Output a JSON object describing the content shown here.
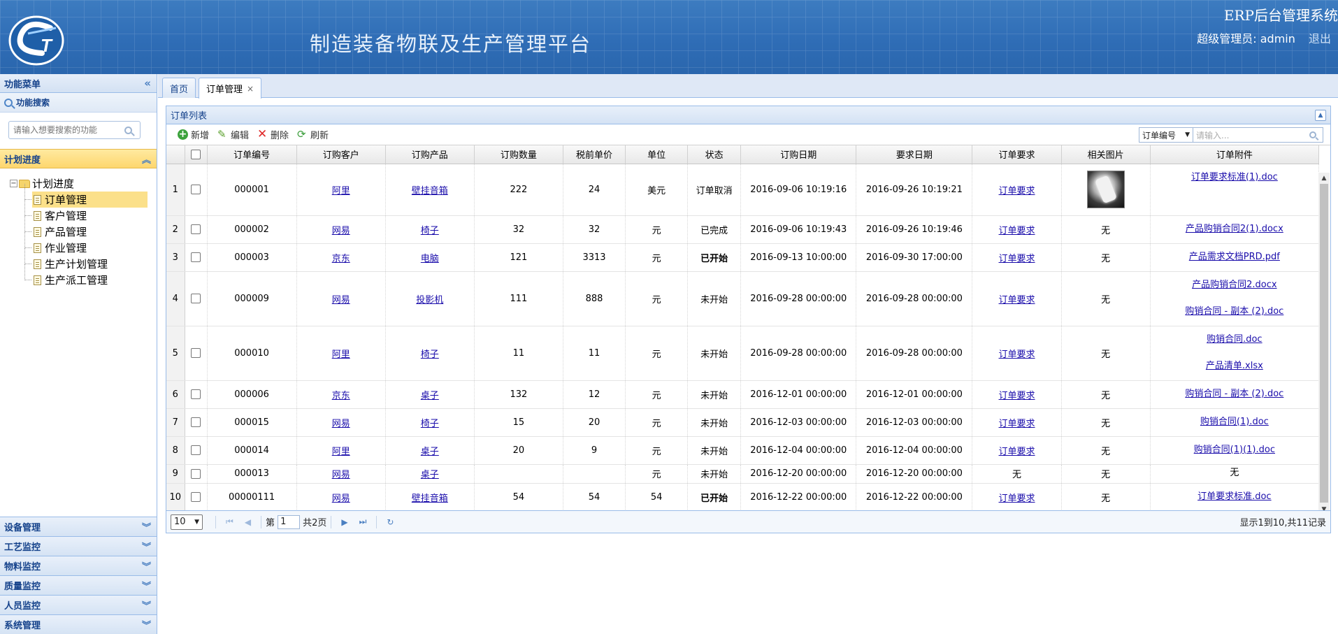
{
  "header": {
    "title": "制造装备物联及生产管理平台",
    "system_name": "ERP后台管理系统",
    "user_label": "超级管理员: admin",
    "logout": "退出",
    "logo_text": "CST"
  },
  "sidebar": {
    "menu_title": "功能菜单",
    "search_title": "功能搜索",
    "search_placeholder": "请输入想要搜索的功能",
    "current_section": "计划进度",
    "tree_root": "计划进度",
    "tree_items": [
      {
        "label": "订单管理"
      },
      {
        "label": "客户管理"
      },
      {
        "label": "产品管理"
      },
      {
        "label": "作业管理"
      },
      {
        "label": "生产计划管理"
      },
      {
        "label": "生产派工管理"
      }
    ],
    "sections": [
      {
        "label": "设备管理"
      },
      {
        "label": "工艺监控"
      },
      {
        "label": "物料监控"
      },
      {
        "label": "质量监控"
      },
      {
        "label": "人员监控"
      },
      {
        "label": "系统管理"
      }
    ]
  },
  "tabs": [
    {
      "label": "首页"
    },
    {
      "label": "订单管理"
    }
  ],
  "panel": {
    "title": "订单列表",
    "toolbar": {
      "add": "新增",
      "edit": "编辑",
      "delete": "删除",
      "refresh": "刷新"
    },
    "search_field": "订单编号",
    "search_placeholder": "请输入..."
  },
  "columns": [
    "订单编号",
    "订购客户",
    "订购产品",
    "订购数量",
    "税前单价",
    "单位",
    "状态",
    "订购日期",
    "要求日期",
    "订单要求",
    "相关图片",
    "订单附件"
  ],
  "rows": [
    {
      "n": "1",
      "id": "000001",
      "customer": "阿里",
      "product": "壁挂音箱",
      "qty": "222",
      "price": "24",
      "unit": "美元",
      "status": "订单取消",
      "order_date": "2016-09-06 10:19:16",
      "req_date": "2016-09-26 10:19:21",
      "req": "订单要求",
      "image": "",
      "attachments": [
        "订单要求标准(1).doc"
      ]
    },
    {
      "n": "2",
      "id": "000002",
      "customer": "网易",
      "product": "椅子",
      "qty": "32",
      "price": "32",
      "unit": "元",
      "status": "已完成",
      "order_date": "2016-09-06 10:19:43",
      "req_date": "2016-09-26 10:19:46",
      "req": "订单要求",
      "image": "无",
      "attachments": [
        "产品购销合同2(1).docx"
      ]
    },
    {
      "n": "3",
      "id": "000003",
      "customer": "京东",
      "product": "电脑",
      "qty": "121",
      "price": "3313",
      "unit": "元",
      "status": "已开始",
      "order_date": "2016-09-13 10:00:00",
      "req_date": "2016-09-30 17:00:00",
      "req": "订单要求",
      "image": "无",
      "attachments": [
        "产品需求文档PRD.pdf"
      ]
    },
    {
      "n": "4",
      "id": "000009",
      "customer": "网易",
      "product": "投影机",
      "qty": "111",
      "price": "888",
      "unit": "元",
      "status": "未开始",
      "order_date": "2016-09-28 00:00:00",
      "req_date": "2016-09-28 00:00:00",
      "req": "订单要求",
      "image": "无",
      "attachments": [
        "产品购销合同2.docx",
        "购销合同 - 副本 (2).doc"
      ]
    },
    {
      "n": "5",
      "id": "000010",
      "customer": "阿里",
      "product": "椅子",
      "qty": "11",
      "price": "11",
      "unit": "元",
      "status": "未开始",
      "order_date": "2016-09-28 00:00:00",
      "req_date": "2016-09-28 00:00:00",
      "req": "订单要求",
      "image": "无",
      "attachments": [
        "购销合同.doc",
        "产品清单.xlsx"
      ]
    },
    {
      "n": "6",
      "id": "000006",
      "customer": "京东",
      "product": "桌子",
      "qty": "132",
      "price": "12",
      "unit": "元",
      "status": "未开始",
      "order_date": "2016-12-01 00:00:00",
      "req_date": "2016-12-01 00:00:00",
      "req": "订单要求",
      "image": "无",
      "attachments": [
        "购销合同 - 副本 (2).doc"
      ]
    },
    {
      "n": "7",
      "id": "000015",
      "customer": "网易",
      "product": "椅子",
      "qty": "15",
      "price": "20",
      "unit": "元",
      "status": "未开始",
      "order_date": "2016-12-03 00:00:00",
      "req_date": "2016-12-03 00:00:00",
      "req": "订单要求",
      "image": "无",
      "attachments": [
        "购销合同(1).doc"
      ]
    },
    {
      "n": "8",
      "id": "000014",
      "customer": "阿里",
      "product": "桌子",
      "qty": "20",
      "price": "9",
      "unit": "元",
      "status": "未开始",
      "order_date": "2016-12-04 00:00:00",
      "req_date": "2016-12-04 00:00:00",
      "req": "订单要求",
      "image": "无",
      "attachments": [
        "购销合同(1)(1).doc"
      ]
    },
    {
      "n": "9",
      "id": "000013",
      "customer": "网易",
      "product": "桌子",
      "qty": "",
      "price": "",
      "unit": "元",
      "status": "未开始",
      "order_date": "2016-12-20 00:00:00",
      "req_date": "2016-12-20 00:00:00",
      "req": "无",
      "image": "无",
      "attachments": [
        "无"
      ]
    },
    {
      "n": "10",
      "id": "00000111",
      "customer": "网易",
      "product": "壁挂音箱",
      "qty": "54",
      "price": "54",
      "unit": "54",
      "status": "已开始",
      "order_date": "2016-12-22 00:00:00",
      "req_date": "2016-12-22 00:00:00",
      "req": "订单要求",
      "image": "无",
      "attachments": [
        "订单要求标准.doc"
      ]
    }
  ],
  "pager": {
    "page_size": "10",
    "page_label": "第",
    "page_value": "1",
    "total_pages": "共2页",
    "info": "显示1到10,共11记录"
  },
  "colors": {
    "header_bg": "#2f6db6",
    "selected_bg": "#fbe08a",
    "status_cancel": "#e00000",
    "status_done": "#1a8a1a"
  }
}
